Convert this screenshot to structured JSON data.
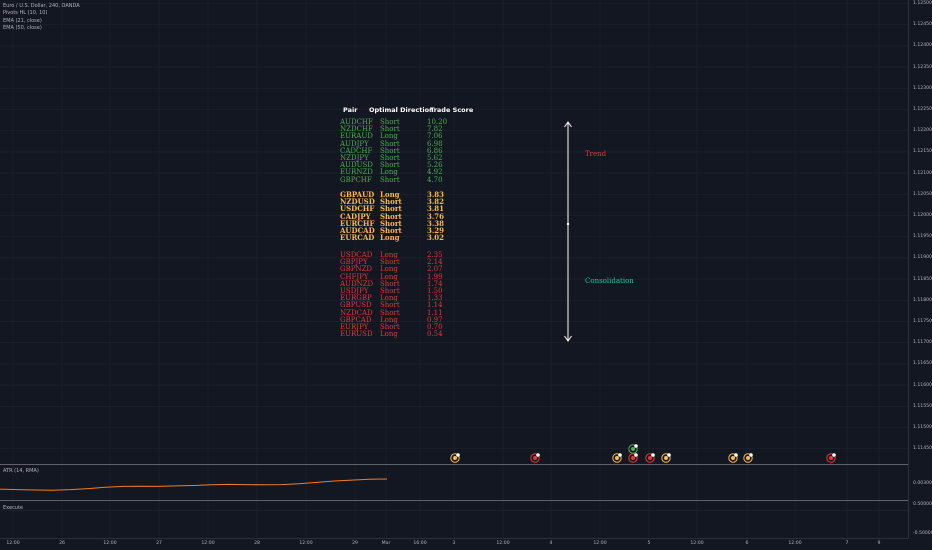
{
  "legend": {
    "title": "Euro / U.S. Dollar, 240, OANDA",
    "ind1": "Pivots HL (10, 10)",
    "ind2": "EMA (21, close)",
    "ind3": "EMA (50, close)"
  },
  "panes": {
    "atr_label": "ATR (14, RMA)",
    "execute_label": "Execute"
  },
  "colors": {
    "background": "#131722",
    "green": "#4caf50",
    "yellow": "#ffb84d",
    "red": "#e53935",
    "white": "#ffffff",
    "teal": "#26c6a0",
    "atr_line": "#f57c20"
  },
  "table": {
    "headers": [
      "Pair",
      "Optimal Direction",
      "Trade Score"
    ],
    "groups": [
      {
        "color": "green",
        "rows": [
          [
            "AUDCHF",
            "Short",
            "10.20"
          ],
          [
            "NZDCHF",
            "Short",
            "7.82"
          ],
          [
            "EURAUD",
            "Long",
            "7.06"
          ],
          [
            "AUDJPY",
            "Short",
            "6.98"
          ],
          [
            "CADCHF",
            "Short",
            "6.86"
          ],
          [
            "NZDJPY",
            "Short",
            "5.62"
          ],
          [
            "AUDUSD",
            "Short",
            "5.26"
          ],
          [
            "EURNZD",
            "Long",
            "4.92"
          ],
          [
            "GBPCHF",
            "Short",
            "4.70"
          ]
        ]
      },
      {
        "color": "yellow",
        "rows": [
          [
            "GBPAUD",
            "Long",
            "3.83"
          ],
          [
            "NZDUSD",
            "Short",
            "3.82"
          ],
          [
            "USDCHF",
            "Short",
            "3.81"
          ],
          [
            "CADJPY",
            "Short",
            "3.76"
          ],
          [
            "EURCHF",
            "Short",
            "3.38"
          ],
          [
            "AUDCAD",
            "Short",
            "3.29"
          ],
          [
            "EURCAD",
            "Long",
            "3.02"
          ]
        ]
      },
      {
        "color": "red",
        "rows": [
          [
            "USDCAD",
            "Long",
            "2.35"
          ],
          [
            "GBPJPY",
            "Short",
            "2.14"
          ],
          [
            "GBPNZD",
            "Long",
            "2.07"
          ],
          [
            "CHFJPY",
            "Long",
            "1.99"
          ],
          [
            "AUDNZD",
            "Short",
            "1.74"
          ],
          [
            "USDJPY",
            "Short",
            "1.50"
          ],
          [
            "EURGBP",
            "Long",
            "1.33"
          ],
          [
            "GBPUSD",
            "Short",
            "1.14"
          ],
          [
            "NZDCAD",
            "Short",
            "1.11"
          ],
          [
            "GBPCAD",
            "Long",
            "0.97"
          ],
          [
            "EURJPY",
            "Short",
            "0.70"
          ],
          [
            "EURUSD",
            "Long",
            "0.54"
          ]
        ]
      }
    ]
  },
  "annotations": {
    "trend": "Trend",
    "consolidation": "Consolidation"
  },
  "price_axis": [
    "1.12500",
    "1.12450",
    "1.12400",
    "1.12350",
    "1.12300",
    "1.12250",
    "1.12200",
    "1.12150",
    "1.12100",
    "1.12050",
    "1.12000",
    "1.11950",
    "1.11900",
    "1.11850",
    "1.11800",
    "1.11750",
    "1.11700",
    "1.11650",
    "1.11600",
    "1.11550",
    "1.11500",
    "1.11450"
  ],
  "atr_axis": [
    "0.00300"
  ],
  "exec_axis": [
    "0.50000",
    "-0.50000"
  ],
  "time_axis": [
    "12:00",
    "26",
    "12:00",
    "27",
    "12:00",
    "28",
    "12:00",
    "29",
    "Mar",
    "16:00",
    "3",
    "12:00",
    "4",
    "12:00",
    "5",
    "12:00",
    "6",
    "12:00",
    "7",
    "9"
  ],
  "chart_data": {
    "type": "line",
    "title": "Euro / U.S. Dollar, 240, OANDA",
    "atr_series": {
      "name": "ATR (14, RMA)",
      "values": [
        0.0021,
        0.00205,
        0.002,
        0.00198,
        0.00205,
        0.00215,
        0.0023,
        0.0024,
        0.00242,
        0.0024,
        0.00245,
        0.0025,
        0.00258,
        0.00262,
        0.0026,
        0.00258,
        0.0026,
        0.0027,
        0.00285,
        0.003,
        0.0031,
        0.0032,
        0.00322
      ]
    },
    "markers": [
      {
        "x": "3",
        "type": "pivot"
      },
      {
        "x": "4",
        "type": "pivot"
      },
      {
        "x": "5",
        "type": "pivot"
      },
      {
        "x": "5",
        "type": "pivot"
      },
      {
        "x": "5",
        "type": "pivot"
      },
      {
        "x": "5",
        "type": "pivot"
      },
      {
        "x": "6",
        "type": "pivot"
      },
      {
        "x": "6",
        "type": "pivot"
      },
      {
        "x": "7",
        "type": "pivot"
      }
    ]
  }
}
